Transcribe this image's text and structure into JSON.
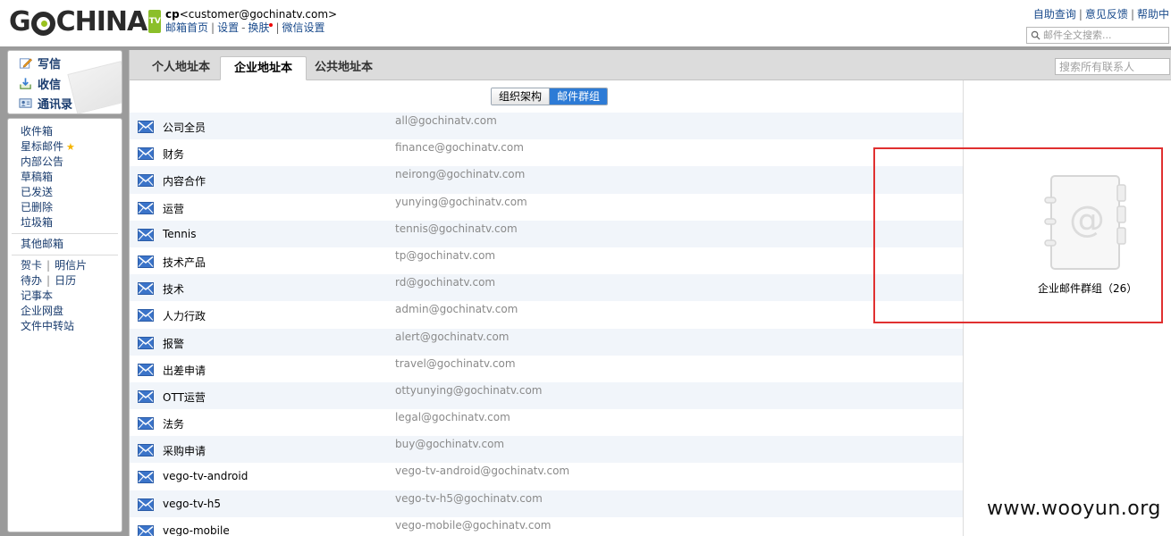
{
  "brand": {
    "logo_pre": "G",
    "logo_post": "CHINA",
    "logo_tv": "TV"
  },
  "account": {
    "user": "cp",
    "email": "<customer@gochinatv.com>",
    "links": [
      "邮箱首页",
      "设置",
      "换肤",
      "微信设置"
    ]
  },
  "top_links": [
    "自助查询",
    "意见反馈",
    "帮助中"
  ],
  "mail_search": {
    "placeholder": "邮件全文搜索..."
  },
  "actions": {
    "write": "写信",
    "receive": "收信",
    "contacts": "通讯录"
  },
  "folders": {
    "group1": [
      "收件箱",
      "星标邮件",
      "内部公告",
      "草稿箱",
      "已发送",
      "已删除",
      "垃圾箱"
    ],
    "other": "其他邮箱",
    "extras": {
      "greeting": "贺卡",
      "postcard": "明信片",
      "todo": "待办",
      "calendar": "日历",
      "notes": "记事本",
      "disk": "企业网盘",
      "transfer": "文件中转站"
    }
  },
  "tabs": [
    "个人地址本",
    "企业地址本",
    "公共地址本"
  ],
  "contact_search": {
    "placeholder": "搜索所有联系人"
  },
  "view_toggle": {
    "org": "组织架构",
    "groups": "邮件群组"
  },
  "contacts": [
    {
      "name": "公司全员",
      "email": "all@gochinatv.com"
    },
    {
      "name": "财务",
      "email": "finance@gochinatv.com"
    },
    {
      "name": "内容合作",
      "email": "neirong@gochinatv.com"
    },
    {
      "name": "运营",
      "email": "yunying@gochinatv.com"
    },
    {
      "name": "Tennis",
      "email": "tennis@gochinatv.com"
    },
    {
      "name": "技术产品",
      "email": "tp@gochinatv.com"
    },
    {
      "name": "技术",
      "email": "rd@gochinatv.com"
    },
    {
      "name": "人力行政",
      "email": "admin@gochinatv.com"
    },
    {
      "name": "报警",
      "email": "alert@gochinatv.com"
    },
    {
      "name": "出差申请",
      "email": "travel@gochinatv.com"
    },
    {
      "name": "OTT运营",
      "email": "ottyunying@gochinatv.com"
    },
    {
      "name": "法务",
      "email": "legal@gochinatv.com"
    },
    {
      "name": "采购申请",
      "email": "buy@gochinatv.com"
    },
    {
      "name": "vego-tv-android",
      "email": "vego-tv-android@gochinatv.com"
    },
    {
      "name": "vego-tv-h5",
      "email": "vego-tv-h5@gochinatv.com"
    },
    {
      "name": "vego-mobile",
      "email": "vego-mobile@gochinatv.com"
    }
  ],
  "info": {
    "caption": "企业邮件群组（26）"
  },
  "watermark": "www.wooyun.org",
  "colors": {
    "accent": "#2d7bd6",
    "link": "#1a4b8c",
    "highlight": "#e03030",
    "row_alt": "#f1f5fa"
  }
}
